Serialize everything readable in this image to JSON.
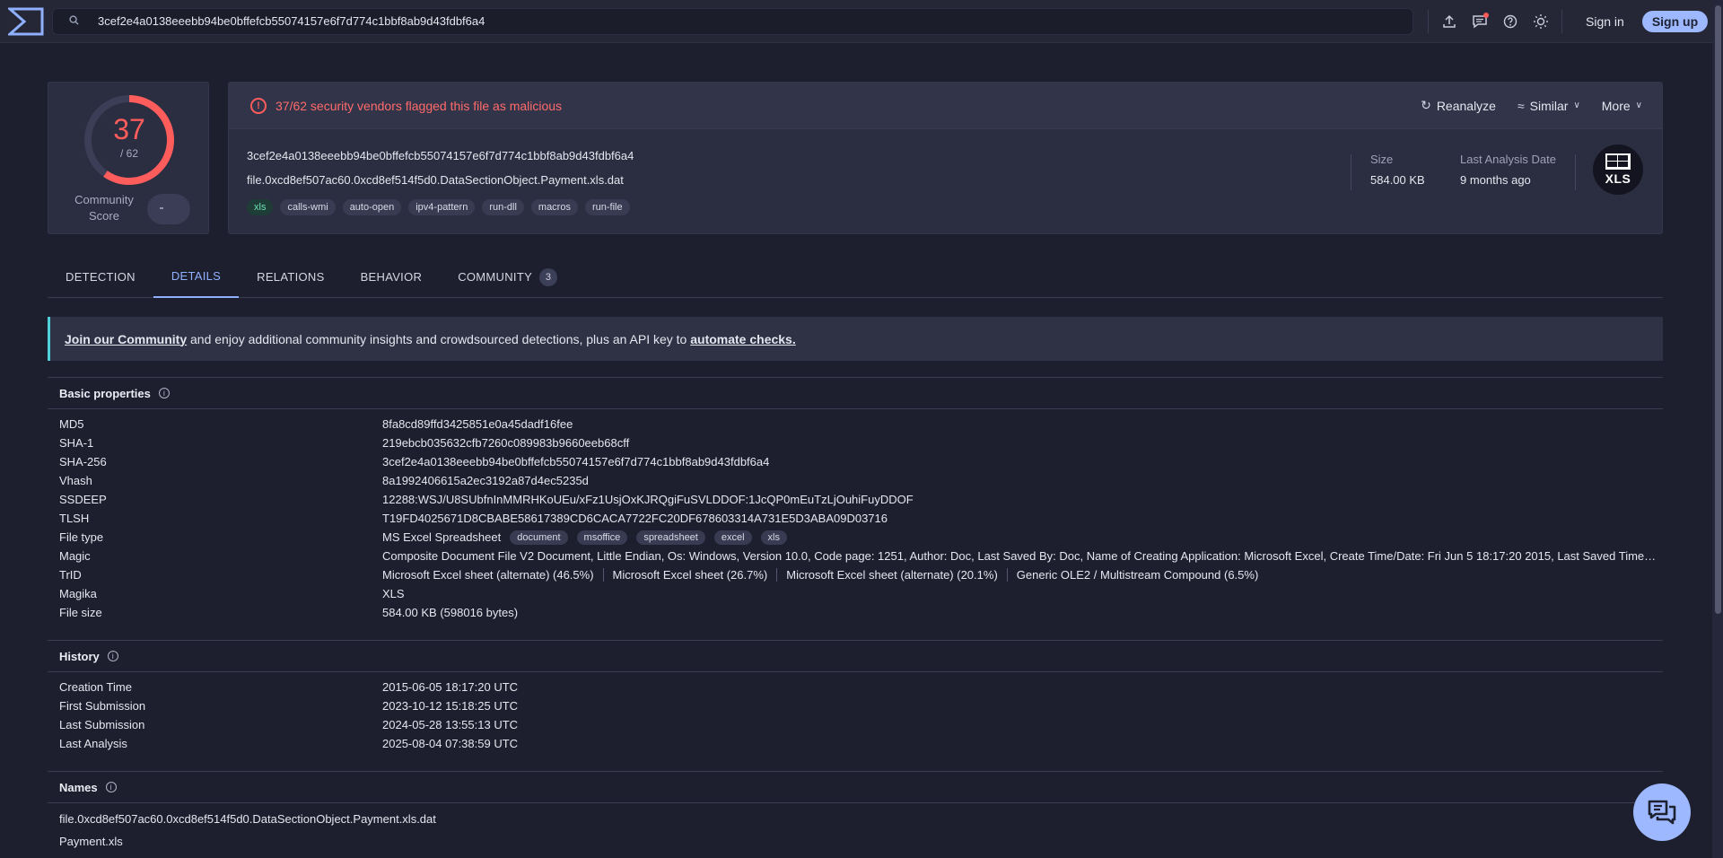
{
  "search": {
    "value": "3cef2e4a0138eeebb94be0bffefcb55074157e6f7d774c1bbf8ab9d43fdbf6a4"
  },
  "auth": {
    "signin": "Sign in",
    "signup": "Sign up"
  },
  "score": {
    "detected": "37",
    "total": "/ 62",
    "fraction": 0.597,
    "community_label_1": "Community",
    "community_label_2": "Score"
  },
  "alert": {
    "text": "37/62 security vendors flagged this file as malicious",
    "reanalyze": "Reanalyze",
    "similar": "Similar",
    "more": "More"
  },
  "file": {
    "hash": "3cef2e4a0138eeebb94be0bffefcb55074157e6f7d774c1bbf8ab9d43fdbf6a4",
    "name": "file.0xcd8ef507ac60.0xcd8ef514f5d0.DataSectionObject.Payment.xls.dat",
    "tags": [
      "xls",
      "calls-wmi",
      "auto-open",
      "ipv4-pattern",
      "run-dll",
      "macros",
      "run-file"
    ],
    "size_label": "Size",
    "size_value": "584.00 KB",
    "date_label": "Last Analysis Date",
    "date_value": "9 months ago",
    "badge": "XLS"
  },
  "tabs": [
    {
      "label": "DETECTION"
    },
    {
      "label": "DETAILS"
    },
    {
      "label": "RELATIONS"
    },
    {
      "label": "BEHAVIOR"
    },
    {
      "label": "COMMUNITY",
      "count": "3"
    }
  ],
  "banner": {
    "link1": "Join our Community",
    "middle": " and enjoy additional community insights and crowdsourced detections, plus an API key to ",
    "link2": "automate checks."
  },
  "basic": {
    "title": "Basic properties",
    "rows": [
      {
        "k": "MD5",
        "v": "8fa8cd89ffd3425851e0a45dadf16fee"
      },
      {
        "k": "SHA-1",
        "v": "219ebcb035632cfb7260c089983b9660eeb68cff"
      },
      {
        "k": "SHA-256",
        "v": "3cef2e4a0138eeebb94be0bffefcb55074157e6f7d774c1bbf8ab9d43fdbf6a4"
      },
      {
        "k": "Vhash",
        "v": "8a1992406615a2ec3192a87d4ec5235d"
      },
      {
        "k": "SSDEEP",
        "v": "12288:WSJ/U8SUbfnInMMRHKoUEu/xFz1UsjOxKJRQgiFuSVLDDOF:1JcQP0mEuTzLjOuhiFuyDDOF"
      },
      {
        "k": "TLSH",
        "v": "T19FD4025671D8CBABE58617389CD6CACA7722FC20DF678603314A731E5D3ABA09D03716"
      },
      {
        "k": "Magic",
        "v": "Composite Document File V2 Document, Little Endian, Os: Windows, Version 10.0, Code page: 1251, Author: Doc, Last Saved By: Doc, Name of Creating Application: Microsoft Excel, Create Time/Date: Fri Jun 5 18:17:20 2015, Last Saved Time/Da..."
      },
      {
        "k": "Magika",
        "v": "XLS"
      },
      {
        "k": "File size",
        "v": "584.00 KB (598016 bytes)"
      }
    ],
    "filetype_label": "File type",
    "filetype_value": "MS Excel Spreadsheet",
    "filetype_tags": [
      "document",
      "msoffice",
      "spreadsheet",
      "excel",
      "xls"
    ],
    "trid_label": "TrID",
    "trid": [
      "Microsoft Excel sheet (alternate) (46.5%)",
      "Microsoft Excel sheet (26.7%)",
      "Microsoft Excel sheet (alternate) (20.1%)",
      "Generic OLE2 / Multistream Compound (6.5%)"
    ]
  },
  "history": {
    "title": "History",
    "rows": [
      {
        "k": "Creation Time",
        "v": "2015-06-05 18:17:20 UTC"
      },
      {
        "k": "First Submission",
        "v": "2023-10-12 15:18:25 UTC"
      },
      {
        "k": "Last Submission",
        "v": "2024-05-28 13:55:13 UTC"
      },
      {
        "k": "Last Analysis",
        "v": "2025-08-04 07:38:59 UTC"
      }
    ]
  },
  "names": {
    "title": "Names",
    "items": [
      "file.0xcd8ef507ac60.0xcd8ef514f5d0.DataSectionObject.Payment.xls.dat",
      "Payment.xls"
    ]
  },
  "colors": {
    "malicious": "#ff5c5c",
    "accent": "#8fb0ff",
    "signup_bg": "#9db8ff"
  },
  "icons": {
    "search": "search-icon",
    "upload": "upload-icon",
    "chat": "chat-icon",
    "help": "help-icon",
    "theme": "sun-icon"
  }
}
